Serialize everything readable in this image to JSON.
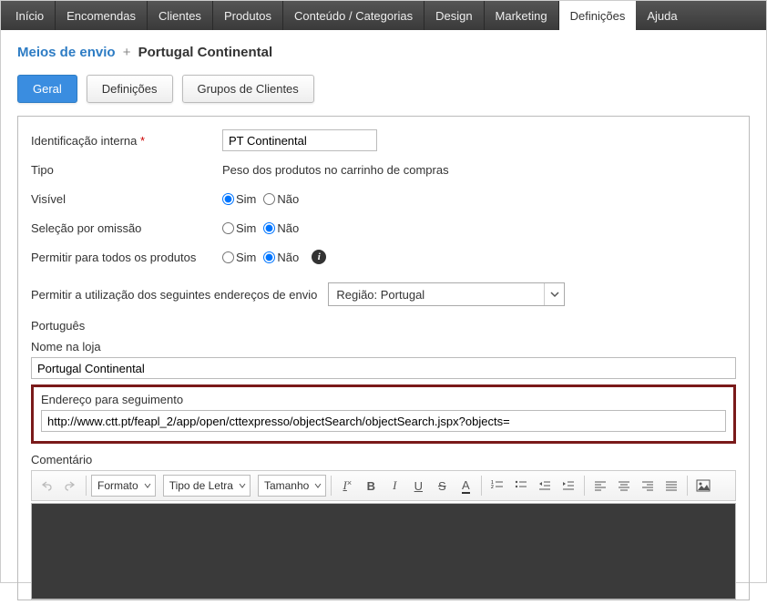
{
  "nav": {
    "items": [
      "Início",
      "Encomendas",
      "Clientes",
      "Produtos",
      "Conteúdo / Categorias",
      "Design",
      "Marketing",
      "Definições",
      "Ajuda"
    ],
    "activeIndex": 7
  },
  "breadcrumb": {
    "parent": "Meios de envio",
    "sep": "+",
    "current": "Portugal Continental"
  },
  "tabs": {
    "items": [
      "Geral",
      "Definições",
      "Grupos de Clientes"
    ],
    "activeIndex": 0
  },
  "form": {
    "id_label": "Identificação interna",
    "id_value": "PT Continental",
    "tipo_label": "Tipo",
    "tipo_value": "Peso dos produtos no carrinho de compras",
    "visivel_label": "Visível",
    "selecao_label": "Seleção por omissão",
    "permitir_label": "Permitir para todos os produtos",
    "sim": "Sim",
    "nao": "Não",
    "envio_label": "Permitir a utilização dos seguintes endereços de envio",
    "envio_select": "Região: Portugal",
    "lang": "Português",
    "nome_loja_label": "Nome na loja",
    "nome_loja_value": "Portugal Continental",
    "tracking_label": "Endereço para seguimento",
    "tracking_value": "http://www.ctt.pt/feapl_2/app/open/cttexpresso/objectSearch/objectSearch.jspx?objects=",
    "comentario_label": "Comentário"
  },
  "editor": {
    "format": "Formato",
    "font": "Tipo de Letra",
    "size": "Tamanho"
  }
}
